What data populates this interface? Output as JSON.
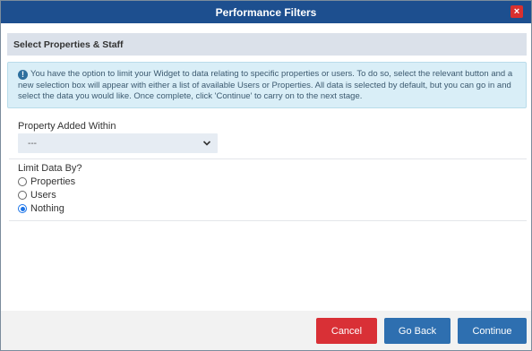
{
  "dialog": {
    "title": "Performance Filters",
    "close_label": "×"
  },
  "section": {
    "header": "Select Properties & Staff"
  },
  "info": {
    "icon_glyph": "!",
    "text": "You have the option to limit your Widget to data relating to specific properties or users. To do so, select the relevant button and a new selection box will appear with either a list of available Users or Properties. All data is selected by default, but you can go in and select the data you would like. Once complete, click 'Continue' to carry on to the next stage."
  },
  "property_added": {
    "label": "Property Added Within",
    "selected": "---"
  },
  "limit_data": {
    "label": "Limit Data By?",
    "options": [
      {
        "label": "Properties",
        "checked": false
      },
      {
        "label": "Users",
        "checked": false
      },
      {
        "label": "Nothing",
        "checked": true
      }
    ]
  },
  "footer": {
    "cancel_label": "Cancel",
    "back_label": "Go Back",
    "continue_label": "Continue"
  },
  "colors": {
    "titlebar": "#1d4f8f",
    "cancel": "#d93036",
    "primary": "#2e6fb0",
    "info_bg": "#d9eef7"
  }
}
